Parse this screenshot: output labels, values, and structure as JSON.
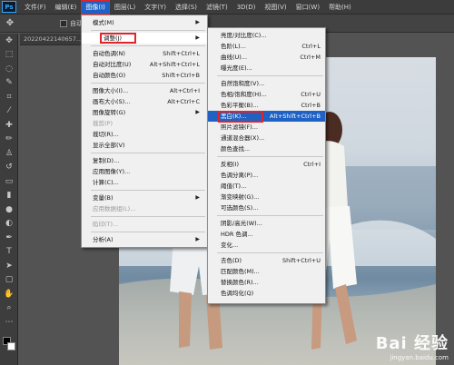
{
  "app_logo": "Ps",
  "menubar": {
    "items": [
      "文件(F)",
      "编辑(E)",
      "图像(I)",
      "图层(L)",
      "文字(Y)",
      "选择(S)",
      "滤镜(T)",
      "3D(D)",
      "视图(V)",
      "窗口(W)",
      "帮助(H)"
    ],
    "active_index": 2
  },
  "options": {
    "auto_select": "自动选择："
  },
  "document_tab": "20220422140657...",
  "image_menu": {
    "items": [
      {
        "label": "模式(M)",
        "shortcut": "",
        "submenu": true
      },
      {
        "label": "调整(J)",
        "shortcut": "",
        "submenu": true
      },
      {
        "label": "自动色调(N)",
        "shortcut": "Shift+Ctrl+L"
      },
      {
        "label": "自动对比度(U)",
        "shortcut": "Alt+Shift+Ctrl+L"
      },
      {
        "label": "自动颜色(O)",
        "shortcut": "Shift+Ctrl+B"
      },
      {
        "label": "图像大小(I)...",
        "shortcut": "Alt+Ctrl+I"
      },
      {
        "label": "画布大小(S)...",
        "shortcut": "Alt+Ctrl+C"
      },
      {
        "label": "图像旋转(G)",
        "shortcut": "",
        "submenu": true
      },
      {
        "label": "裁剪(P)",
        "shortcut": "",
        "disabled": true
      },
      {
        "label": "裁切(R)...",
        "shortcut": ""
      },
      {
        "label": "显示全部(V)",
        "shortcut": ""
      },
      {
        "label": "复制(D)...",
        "shortcut": ""
      },
      {
        "label": "应用图像(Y)...",
        "shortcut": ""
      },
      {
        "label": "计算(C)...",
        "shortcut": ""
      },
      {
        "label": "变量(B)",
        "shortcut": "",
        "submenu": true
      },
      {
        "label": "应用数据组(L)...",
        "shortcut": "",
        "disabled": true
      },
      {
        "label": "陷印(T)...",
        "shortcut": "",
        "disabled": true
      },
      {
        "label": "分析(A)",
        "shortcut": "",
        "submenu": true
      }
    ]
  },
  "adjust_menu": {
    "items": [
      {
        "label": "亮度/对比度(C)...",
        "shortcut": ""
      },
      {
        "label": "色阶(L)...",
        "shortcut": "Ctrl+L"
      },
      {
        "label": "曲线(U)...",
        "shortcut": "Ctrl+M"
      },
      {
        "label": "曝光度(E)...",
        "shortcut": ""
      },
      {
        "label": "自然饱和度(V)...",
        "shortcut": ""
      },
      {
        "label": "色相/饱和度(H)...",
        "shortcut": "Ctrl+U"
      },
      {
        "label": "色彩平衡(B)...",
        "shortcut": "Ctrl+B"
      },
      {
        "label": "黑白(K)...",
        "shortcut": "Alt+Shift+Ctrl+B"
      },
      {
        "label": "照片滤镜(F)...",
        "shortcut": ""
      },
      {
        "label": "通道混合器(X)...",
        "shortcut": ""
      },
      {
        "label": "颜色查找...",
        "shortcut": ""
      },
      {
        "label": "反相(I)",
        "shortcut": "Ctrl+I"
      },
      {
        "label": "色调分离(P)...",
        "shortcut": ""
      },
      {
        "label": "阈值(T)...",
        "shortcut": ""
      },
      {
        "label": "渐变映射(G)...",
        "shortcut": ""
      },
      {
        "label": "可选颜色(S)...",
        "shortcut": ""
      },
      {
        "label": "阴影/高光(W)...",
        "shortcut": ""
      },
      {
        "label": "HDR 色调...",
        "shortcut": ""
      },
      {
        "label": "变化...",
        "shortcut": ""
      },
      {
        "label": "去色(D)",
        "shortcut": "Shift+Ctrl+U"
      },
      {
        "label": "匹配颜色(M)...",
        "shortcut": ""
      },
      {
        "label": "替换颜色(R)...",
        "shortcut": ""
      },
      {
        "label": "色调均化(Q)",
        "shortcut": ""
      }
    ]
  },
  "watermark": {
    "brand": "Bai 经验",
    "url": "jingyan.baidu.com"
  },
  "colors": {
    "accent": "#1f62c4",
    "highlight_box": "#e0242a",
    "ps_blue": "#31a8ff"
  }
}
